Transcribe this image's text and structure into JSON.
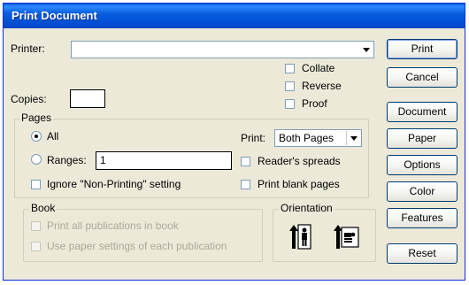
{
  "window": {
    "title": "Print Document"
  },
  "printer": {
    "label": "Printer:",
    "value": ""
  },
  "options": {
    "collate": "Collate",
    "reverse": "Reverse",
    "proof": "Proof"
  },
  "copies": {
    "label": "Copies:",
    "value": ""
  },
  "pages": {
    "title": "Pages",
    "all": "All",
    "ranges": "Ranges:",
    "ranges_value": "1",
    "print_label": "Print:",
    "print_value": "Both Pages",
    "readers_spreads": "Reader's spreads",
    "ignore_non_printing": "Ignore \"Non-Printing\" setting",
    "print_blank_pages": "Print blank pages"
  },
  "book": {
    "title": "Book",
    "print_all": "Print all publications in book",
    "use_paper_settings": "Use paper settings of each publication"
  },
  "orientation": {
    "title": "Orientation"
  },
  "buttons": {
    "print": "Print",
    "cancel": "Cancel",
    "document": "Document",
    "paper": "Paper",
    "options": "Options",
    "color": "Color",
    "features": "Features",
    "reset": "Reset"
  },
  "colors": {
    "titlebar": "#0a5ee0",
    "dialog": "#ece9d8"
  }
}
